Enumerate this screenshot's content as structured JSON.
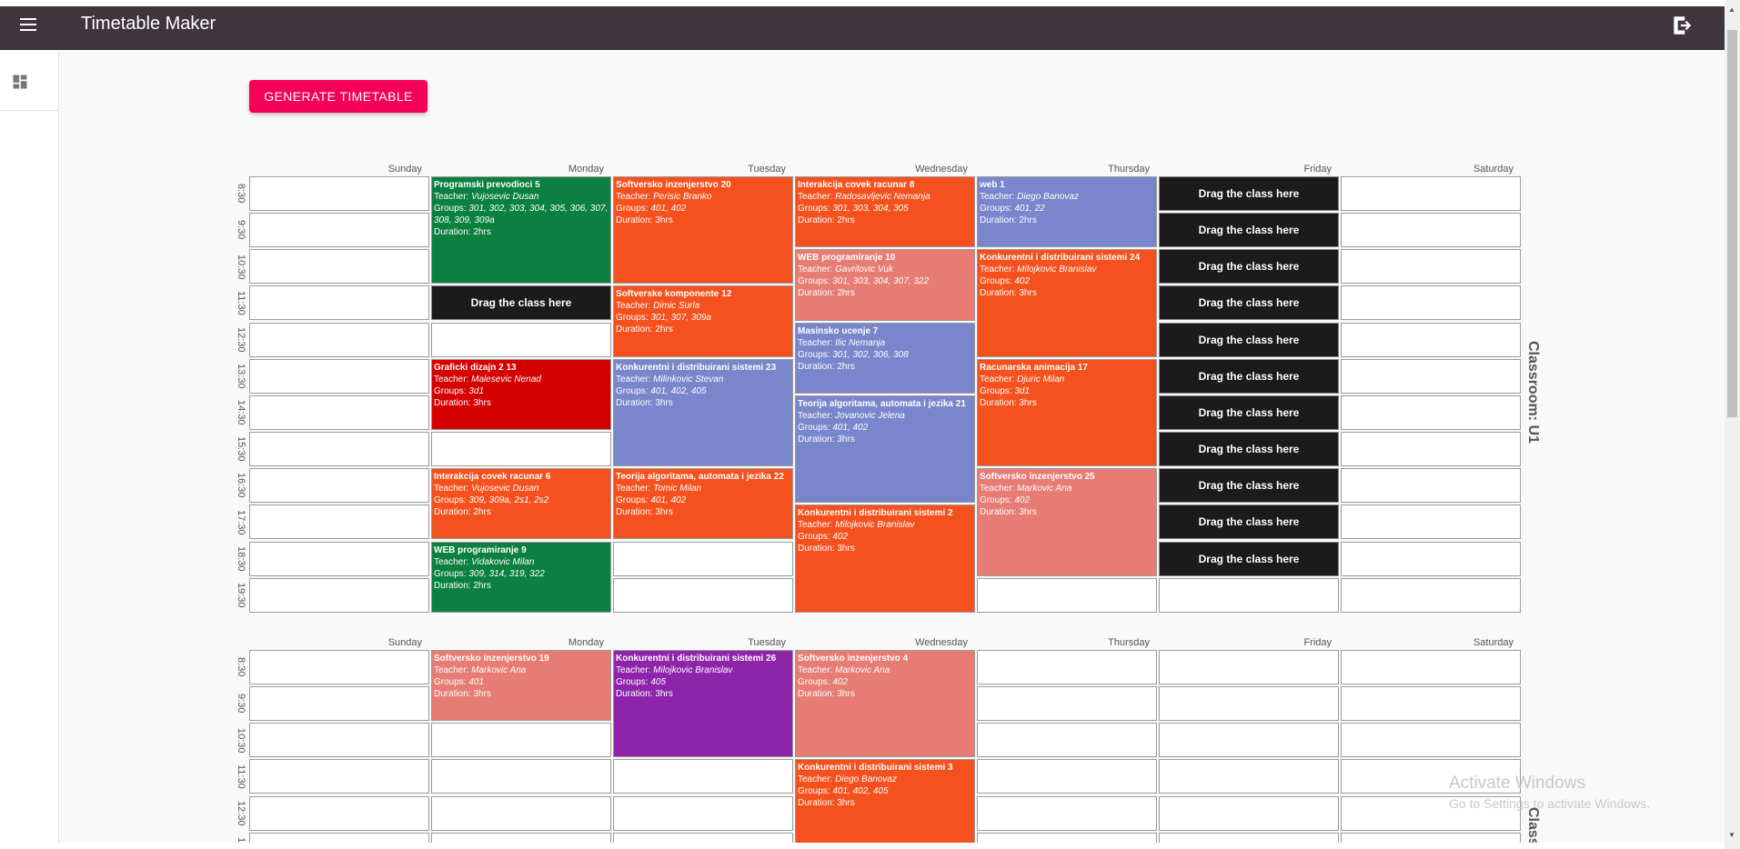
{
  "appbar": {
    "title": "Timetable Maker",
    "menu_icon": "menu-icon",
    "logout_icon": "logout-icon"
  },
  "sidebar": {
    "dashboard_icon": "dashboard-icon"
  },
  "toolbar": {
    "generate_label": "GENERATE TIMETABLE"
  },
  "colors": {
    "appbar": "#3f353d",
    "accent": "#f50057",
    "green": "#0b8040",
    "orange": "#f4511e",
    "indigo": "#7986cb",
    "salmon": "#e67c73",
    "red": "#d50000",
    "purple": "#8e24aa",
    "black": "#1b1b1b"
  },
  "days": [
    "Sunday",
    "Monday",
    "Tuesday",
    "Wednesday",
    "Thursday",
    "Friday",
    "Saturday"
  ],
  "times": [
    "8:30",
    "9:30",
    "10:30",
    "11:30",
    "12:30",
    "13:30",
    "14:30",
    "15:30",
    "16:30",
    "17:30",
    "18:30",
    "19:30"
  ],
  "labels": {
    "teacher": "Teacher: ",
    "groups": "Groups: ",
    "duration": "Duration: "
  },
  "drag_label": "Drag the class here",
  "classrooms": [
    {
      "name": "Classroom: U1",
      "visible_rows": 12,
      "drop_targets": [
        {
          "day": 1,
          "slot": 3
        },
        {
          "day": 5,
          "slot": 0
        },
        {
          "day": 5,
          "slot": 1
        },
        {
          "day": 5,
          "slot": 2
        },
        {
          "day": 5,
          "slot": 3
        },
        {
          "day": 5,
          "slot": 4
        },
        {
          "day": 5,
          "slot": 5
        },
        {
          "day": 5,
          "slot": 6
        },
        {
          "day": 5,
          "slot": 7
        },
        {
          "day": 5,
          "slot": 8
        },
        {
          "day": 5,
          "slot": 9
        },
        {
          "day": 5,
          "slot": 10
        }
      ],
      "classes": [
        {
          "day": 1,
          "slot": 0,
          "span": 3,
          "color": "#0b8040",
          "title": "Programski prevodioci 5",
          "teacher": "Vujosevic Dusan",
          "groups": "301, 302, 303, 304, 305, 306, 307, 308, 309, 309a",
          "duration": "2hrs"
        },
        {
          "day": 1,
          "slot": 5,
          "span": 2,
          "color": "#d50000",
          "title": "Graficki dizajn 2 13",
          "teacher": "Malesevic Nenad",
          "groups": "3d1",
          "duration": "3hrs"
        },
        {
          "day": 1,
          "slot": 8,
          "span": 2,
          "color": "#f4511e",
          "title": "Interakcija covek racunar 6",
          "teacher": "Vujosevic Dusan",
          "groups": "309, 309a, 2s1, 2s2",
          "duration": "2hrs"
        },
        {
          "day": 1,
          "slot": 10,
          "span": 2,
          "color": "#0b8040",
          "title": "WEB programiranje 9",
          "teacher": "Vidakovic Milan",
          "groups": "309, 314, 319, 322",
          "duration": "2hrs"
        },
        {
          "day": 2,
          "slot": 0,
          "span": 3,
          "color": "#f4511e",
          "title": "Softversko inzenjerstvo 20",
          "teacher": "Perisic Branko",
          "groups": "401, 402",
          "duration": "3hrs"
        },
        {
          "day": 2,
          "slot": 3,
          "span": 2,
          "color": "#f4511e",
          "title": "Softverske komponente 12",
          "teacher": "Dimic Surla",
          "groups": "301, 307, 309a",
          "duration": "2hrs"
        },
        {
          "day": 2,
          "slot": 5,
          "span": 3,
          "color": "#7986cb",
          "title": "Konkurentni i distribuirani sistemi 23",
          "teacher": "Milinkovic Stevan",
          "groups": "401, 402, 405",
          "duration": "3hrs"
        },
        {
          "day": 2,
          "slot": 8,
          "span": 2,
          "color": "#f4511e",
          "title": "Teorija algoritama, automata i jezika 22",
          "teacher": "Tomic Milan",
          "groups": "401, 402",
          "duration": "3hrs"
        },
        {
          "day": 3,
          "slot": 0,
          "span": 2,
          "color": "#f4511e",
          "title": "Interakcija covek racunar 8",
          "teacher": "Radosavljevic Nemanja",
          "groups": "301, 303, 304, 305",
          "duration": "2hrs"
        },
        {
          "day": 3,
          "slot": 2,
          "span": 2,
          "color": "#e67c73",
          "title": "WEB programiranje 10",
          "teacher": "Gavrilovic Vuk",
          "groups": "301, 303, 304, 307, 322",
          "duration": "2hrs"
        },
        {
          "day": 3,
          "slot": 4,
          "span": 2,
          "color": "#7986cb",
          "title": "Masinsko ucenje 7",
          "teacher": "Ilic Nemanja",
          "groups": "301, 302, 306, 308",
          "duration": "2hrs"
        },
        {
          "day": 3,
          "slot": 6,
          "span": 3,
          "color": "#7986cb",
          "title": "Teorija algoritama, automata i jezika 21",
          "teacher": "Jovanovic Jelena",
          "groups": "401, 402",
          "duration": "3hrs"
        },
        {
          "day": 3,
          "slot": 9,
          "span": 3,
          "color": "#f4511e",
          "title": "Konkurentni i distribuirani sistemi 2",
          "teacher": "Milojkovic Branislav",
          "groups": "402",
          "duration": "3hrs"
        },
        {
          "day": 4,
          "slot": 0,
          "span": 2,
          "color": "#7986cb",
          "title": "web 1",
          "teacher": "Diego Banovaz",
          "groups": "401, 22",
          "duration": "2hrs"
        },
        {
          "day": 4,
          "slot": 2,
          "span": 3,
          "color": "#f4511e",
          "title": "Konkurentni i distribuirani sistemi 24",
          "teacher": "Milojkovic Branislav",
          "groups": "402",
          "duration": "3hrs"
        },
        {
          "day": 4,
          "slot": 5,
          "span": 3,
          "color": "#f4511e",
          "title": "Racunarska animacija 17",
          "teacher": "Djuric Milan",
          "groups": "3d1",
          "duration": "3hrs"
        },
        {
          "day": 4,
          "slot": 8,
          "span": 3,
          "color": "#e67c73",
          "title": "Softversko inzenjerstvo 25",
          "teacher": "Markovic Ana",
          "groups": "402",
          "duration": "3hrs"
        }
      ]
    },
    {
      "name": "Classro",
      "visible_rows": 6,
      "drop_targets": [],
      "classes": [
        {
          "day": 1,
          "slot": 0,
          "span": 2,
          "color": "#e67c73",
          "title": "Softversko inzenjerstvo 19",
          "teacher": "Markovic Ana",
          "groups": "401",
          "duration": "3hrs"
        },
        {
          "day": 2,
          "slot": 0,
          "span": 3,
          "color": "#8e24aa",
          "title": "Konkurentni i distribuirani sistemi 26",
          "teacher": "Milojkovic Branislav",
          "groups": "405",
          "duration": "3hrs"
        },
        {
          "day": 3,
          "slot": 0,
          "span": 3,
          "color": "#e67c73",
          "title": "Softversko inzenjerstvo 4",
          "teacher": "Markovic Ana",
          "groups": "402",
          "duration": "3hrs"
        },
        {
          "day": 3,
          "slot": 3,
          "span": 3,
          "color": "#f4511e",
          "title": "Konkurentni i distribuirani sistemi 3",
          "teacher": "Diego Banovaz",
          "groups": "401, 402, 405",
          "duration": "3hrs"
        }
      ]
    }
  ],
  "watermark": {
    "line1": "Activate Windows",
    "line2": "Go to Settings to activate Windows."
  }
}
